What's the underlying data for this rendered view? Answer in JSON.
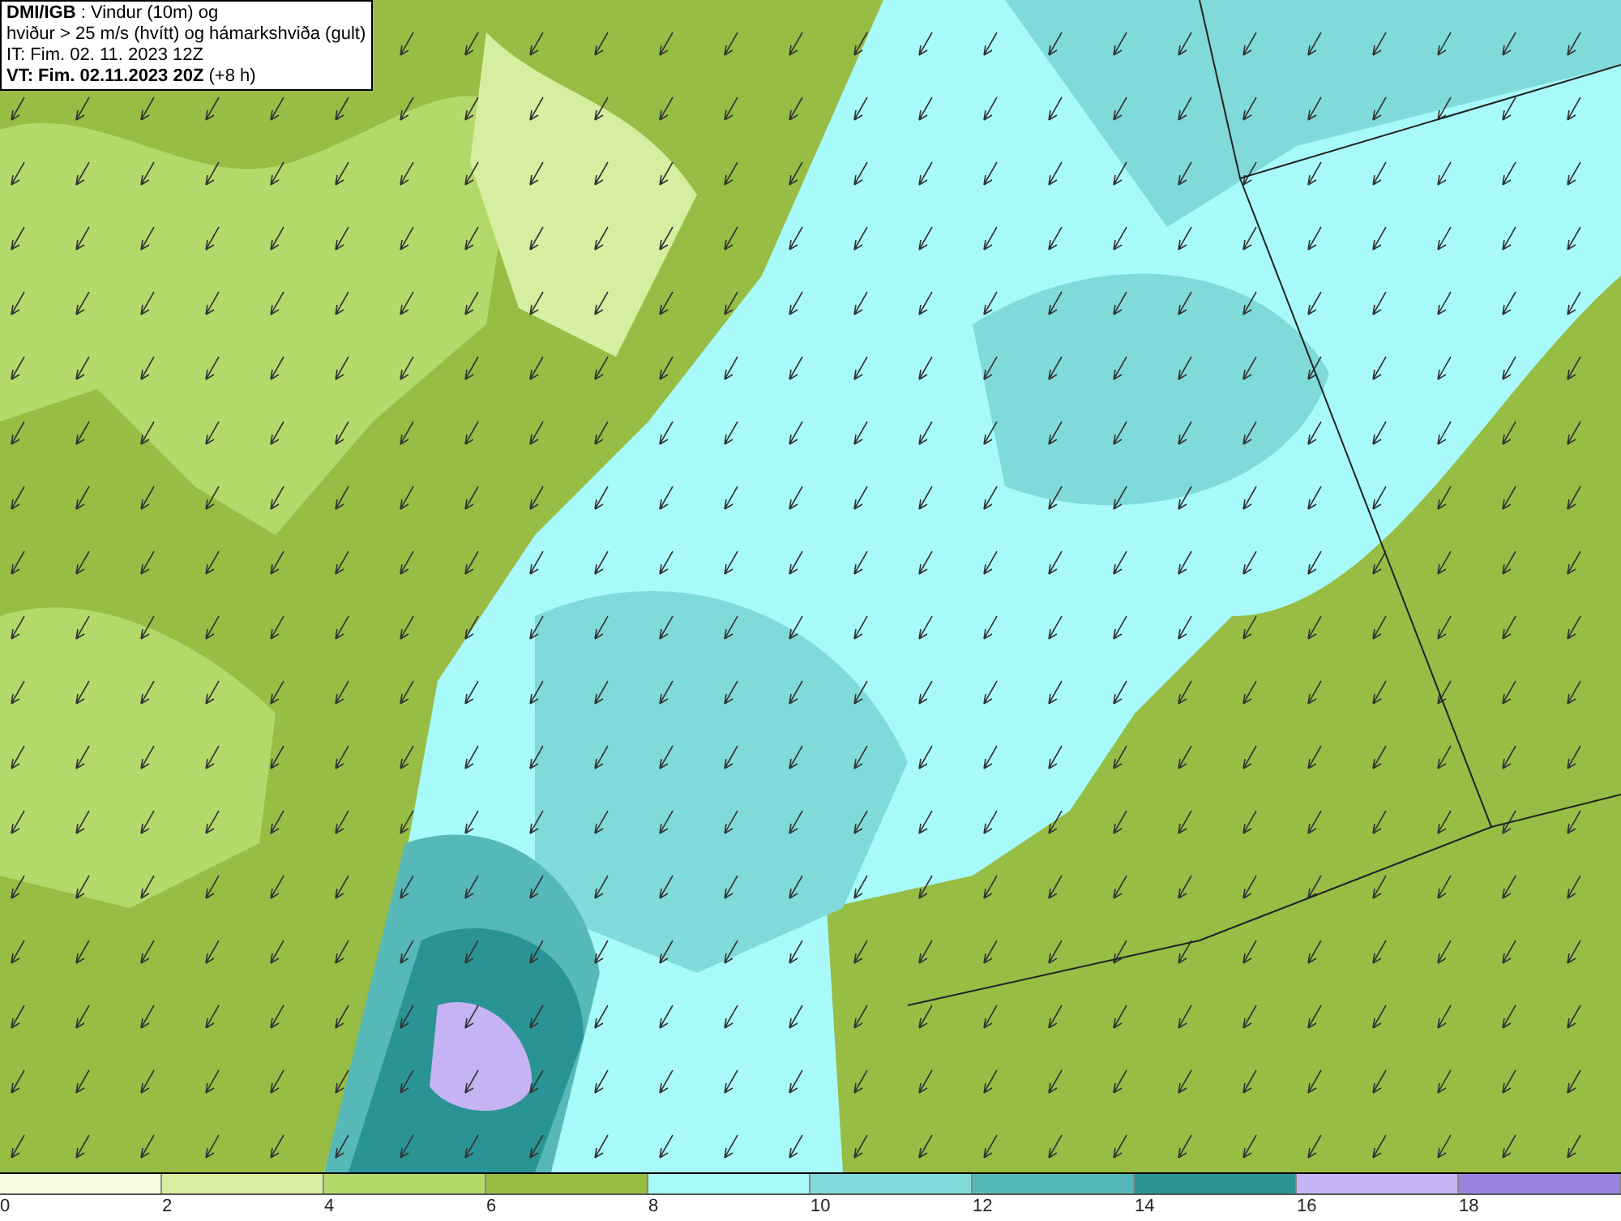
{
  "info_box": {
    "lines": [
      "**DMI/IGB** : Vindur (10m) og",
      "hviður > 25 m/s (hvítt) og hámarkshviða (gult)",
      "IT: Fim. 02. 11. 2023 12Z",
      "**VT: Fim. 02.11.2023 20Z** (+8 h)"
    ]
  },
  "legend": {
    "bins": [
      {
        "color": "#f4fbdf"
      },
      {
        "color": "#d6eea0"
      },
      {
        "color": "#b4d96b"
      },
      {
        "color": "#97bd45"
      },
      {
        "color": "#a8fafa"
      },
      {
        "color": "#80dada"
      },
      {
        "color": "#57b8b8"
      },
      {
        "color": "#2a9494"
      },
      {
        "color": "#c6b3f3"
      },
      {
        "color": "#9b82df"
      }
    ],
    "ticks": [
      "0",
      "2",
      "4",
      "6",
      "8",
      "10",
      "12",
      "14",
      "16",
      "18"
    ]
  }
}
